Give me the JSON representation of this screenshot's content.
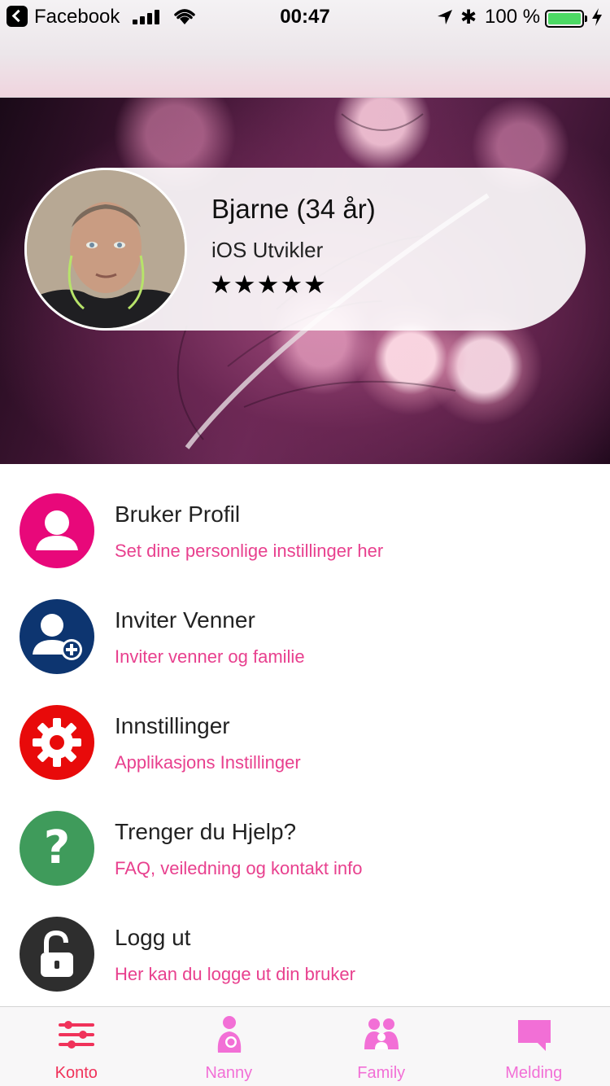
{
  "status_bar": {
    "back_app": "Facebook",
    "time": "00:47",
    "battery_percent": "100 %",
    "battery_color": "#4cd964"
  },
  "profile": {
    "name": "Bjarne (34 år)",
    "title": "iOS Utvikler",
    "rating_stars": "★★★★★",
    "rating": 5
  },
  "menu": {
    "items": [
      {
        "title": "Bruker Profil",
        "subtitle": "Set dine personlige instillinger her",
        "icon": "user-icon",
        "color": "#e8087a"
      },
      {
        "title": "Inviter Venner",
        "subtitle": "Inviter venner og familie",
        "icon": "add-user-icon",
        "color": "#0d3570"
      },
      {
        "title": "Innstillinger",
        "subtitle": "Applikasjons Instillinger",
        "icon": "gear-icon",
        "color": "#e80a0a"
      },
      {
        "title": "Trenger du Hjelp?",
        "subtitle": "FAQ, veiledning og kontakt info",
        "icon": "question-icon",
        "color": "#3f9b5b"
      },
      {
        "title": "Logg ut",
        "subtitle": "Her kan du logge ut din bruker",
        "icon": "unlock-icon",
        "color": "#2e2e2e"
      }
    ],
    "subtitle_color": "#e8408e"
  },
  "tab_bar": {
    "tabs": [
      {
        "label": "Konto",
        "icon": "sliders-icon",
        "color": "#f0325a",
        "active": true
      },
      {
        "label": "Nanny",
        "icon": "nanny-icon",
        "color": "#f26fd6",
        "active": false
      },
      {
        "label": "Family",
        "icon": "family-icon",
        "color": "#f26fd6",
        "active": false
      },
      {
        "label": "Melding",
        "icon": "message-icon",
        "color": "#f26fd6",
        "active": false
      }
    ]
  }
}
